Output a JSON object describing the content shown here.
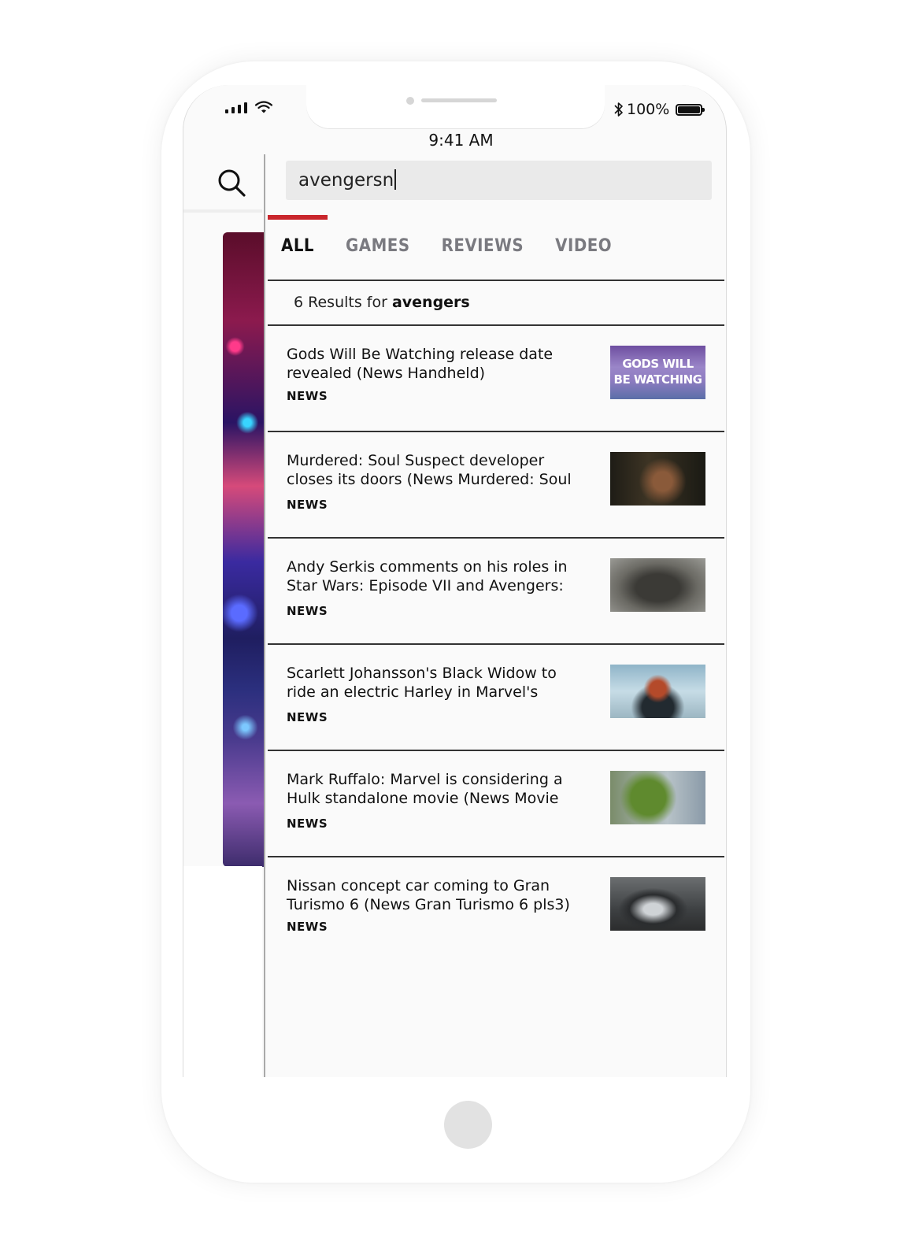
{
  "status_bar": {
    "time": "9:41 AM",
    "battery": "100%",
    "icons": [
      "signal-icon",
      "wifi-icon",
      "bluetooth-icon",
      "battery-icon"
    ]
  },
  "search": {
    "query": "avengersn"
  },
  "tabs": [
    {
      "label": "ALL",
      "active": true
    },
    {
      "label": "GAMES",
      "active": false
    },
    {
      "label": "REVIEWS",
      "active": false
    },
    {
      "label": "VIDEO",
      "active": false
    }
  ],
  "results_summary": {
    "prefix": "6 Results for ",
    "term": "avengers"
  },
  "results": [
    {
      "title": "Gods Will Be Watching release date revealed (News Handheld)",
      "tag": "NEWS",
      "thumb_text": [
        "GODS WILL",
        "BE WATCHING"
      ]
    },
    {
      "title": "Murdered: Soul Suspect developer closes its doors (News Murdered: Soul",
      "tag": "NEWS"
    },
    {
      "title": "Andy Serkis comments on his roles in Star Wars: Episode VII and Avengers:",
      "tag": "NEWS"
    },
    {
      "title": "Scarlett Johansson's Black Widow to ride an electric Harley in Marvel's",
      "tag": "NEWS"
    },
    {
      "title": "Mark Ruffalo: Marvel is considering a Hulk standalone movie (News Movie",
      "tag": "NEWS"
    },
    {
      "title": "Nissan concept car coming to Gran Turismo 6 (News Gran Turismo 6 pls3)",
      "tag": "NEWS"
    }
  ],
  "colors": {
    "accent": "#c9262c",
    "tab_inactive": "#7a7a80",
    "text": "#111111"
  }
}
